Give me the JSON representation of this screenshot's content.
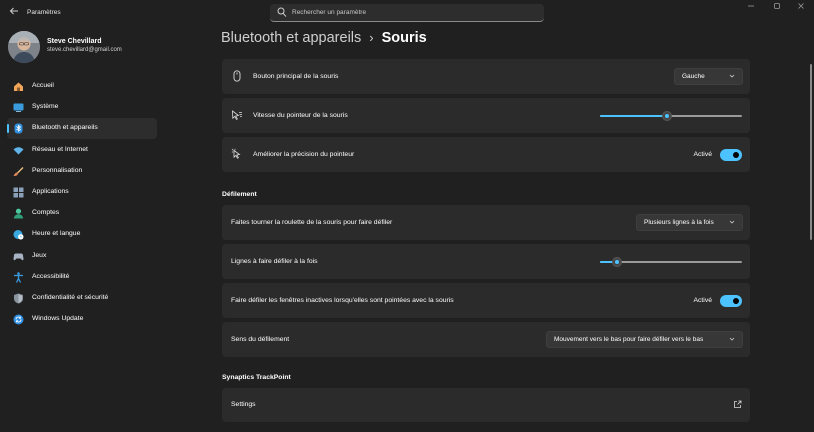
{
  "app": {
    "title": "Paramètres"
  },
  "search": {
    "placeholder": "Rechercher un paramètre"
  },
  "profile": {
    "name": "Steve Chevillard",
    "email": "steve.chevillard@gmail.com"
  },
  "sidebar": {
    "items": [
      {
        "label": "Accueil",
        "icon": "home-icon",
        "color": "#f2a65a",
        "active": false
      },
      {
        "label": "Système",
        "icon": "monitor-icon",
        "color": "#3a9bdc",
        "active": false
      },
      {
        "label": "Bluetooth et appareils",
        "icon": "bluetooth-icon",
        "color": "#2f8fe0",
        "active": true
      },
      {
        "label": "Réseau et Internet",
        "icon": "wifi-icon",
        "color": "#5fb3e8",
        "active": false
      },
      {
        "label": "Personnalisation",
        "icon": "brush-icon",
        "color": "#e0885a",
        "active": false
      },
      {
        "label": "Applications",
        "icon": "apps-icon",
        "color": "#8aa0b8",
        "active": false
      },
      {
        "label": "Comptes",
        "icon": "person-icon",
        "color": "#4cc9a0",
        "active": false
      },
      {
        "label": "Heure et langue",
        "icon": "globe-clock-icon",
        "color": "#3aa8e0",
        "active": false
      },
      {
        "label": "Jeux",
        "icon": "gamepad-icon",
        "color": "#a8b4c4",
        "active": false
      },
      {
        "label": "Accessibilité",
        "icon": "accessibility-icon",
        "color": "#3a9be0",
        "active": false
      },
      {
        "label": "Confidentialité et sécurité",
        "icon": "shield-icon",
        "color": "#8a93a0",
        "active": false
      },
      {
        "label": "Windows Update",
        "icon": "update-icon",
        "color": "#2f8fe0",
        "active": false
      }
    ]
  },
  "breadcrumb": {
    "parent": "Bluetooth et appareils",
    "separator": "›",
    "current": "Souris"
  },
  "settings": {
    "primary_button": {
      "label": "Bouton principal de la souris",
      "value": "Gauche",
      "icon": "mouse-icon"
    },
    "pointer_speed": {
      "label": "Vitesse du pointeur de la souris",
      "value_fraction": 0.47,
      "icon": "pointer-speed-icon"
    },
    "precision": {
      "label": "Améliorer la précision du pointeur",
      "state": "Activé",
      "on": true,
      "icon": "precision-pointer-icon"
    }
  },
  "scrolling": {
    "title": "Défilement",
    "wheel": {
      "label": "Faites tourner la roulette de la souris pour faire défiler",
      "value": "Plusieurs lignes à la fois"
    },
    "lines": {
      "label": "Lignes à faire défiler à la fois",
      "value_fraction": 0.12
    },
    "inactive": {
      "label": "Faire défiler les fenêtres inactives lorsqu'elles sont pointées avec la souris",
      "state": "Activé",
      "on": true
    },
    "direction": {
      "label": "Sens du défilement",
      "value": "Mouvement vers le bas pour faire défiler vers le bas"
    }
  },
  "trackpoint": {
    "title": "Synaptics TrackPoint",
    "settings_label": "Settings"
  },
  "colors": {
    "accent": "#4cc2ff",
    "card": "#2b2b2b",
    "background": "#202020"
  }
}
